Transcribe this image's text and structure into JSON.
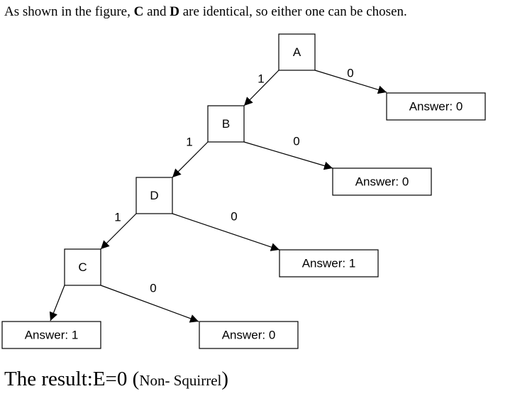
{
  "intro": {
    "before": "As shown in the figure, ",
    "bold1": "C",
    "mid": " and ",
    "bold2": "D",
    "after": " are identical, so either one can be chosen."
  },
  "tree": {
    "nodes": [
      {
        "id": "A",
        "label": "A"
      },
      {
        "id": "B",
        "label": "B"
      },
      {
        "id": "D",
        "label": "D"
      },
      {
        "id": "C",
        "label": "C"
      }
    ],
    "answers": [
      {
        "id": "ans1",
        "label": "Answer:  0"
      },
      {
        "id": "ans2",
        "label": "Answer:  0"
      },
      {
        "id": "ans3",
        "label": "Answer:  1"
      },
      {
        "id": "ans4",
        "label": "Answer:  1"
      },
      {
        "id": "ans5",
        "label": "Answer:  0"
      }
    ],
    "edges": [
      {
        "from": "A",
        "to": "B",
        "label": "1"
      },
      {
        "from": "A",
        "to": "ans1",
        "label": "0"
      },
      {
        "from": "B",
        "to": "D",
        "label": "1"
      },
      {
        "from": "B",
        "to": "ans2",
        "label": "0"
      },
      {
        "from": "D",
        "to": "C",
        "label": "1"
      },
      {
        "from": "D",
        "to": "ans3",
        "label": "0"
      },
      {
        "from": "C",
        "to": "ans4",
        "label": ""
      },
      {
        "from": "C",
        "to": "ans5",
        "label": "0"
      }
    ]
  },
  "result": {
    "main": "The result:E=0 ",
    "paren_open": "(",
    "note": "Non- Squirrel",
    "paren_close": ")"
  }
}
